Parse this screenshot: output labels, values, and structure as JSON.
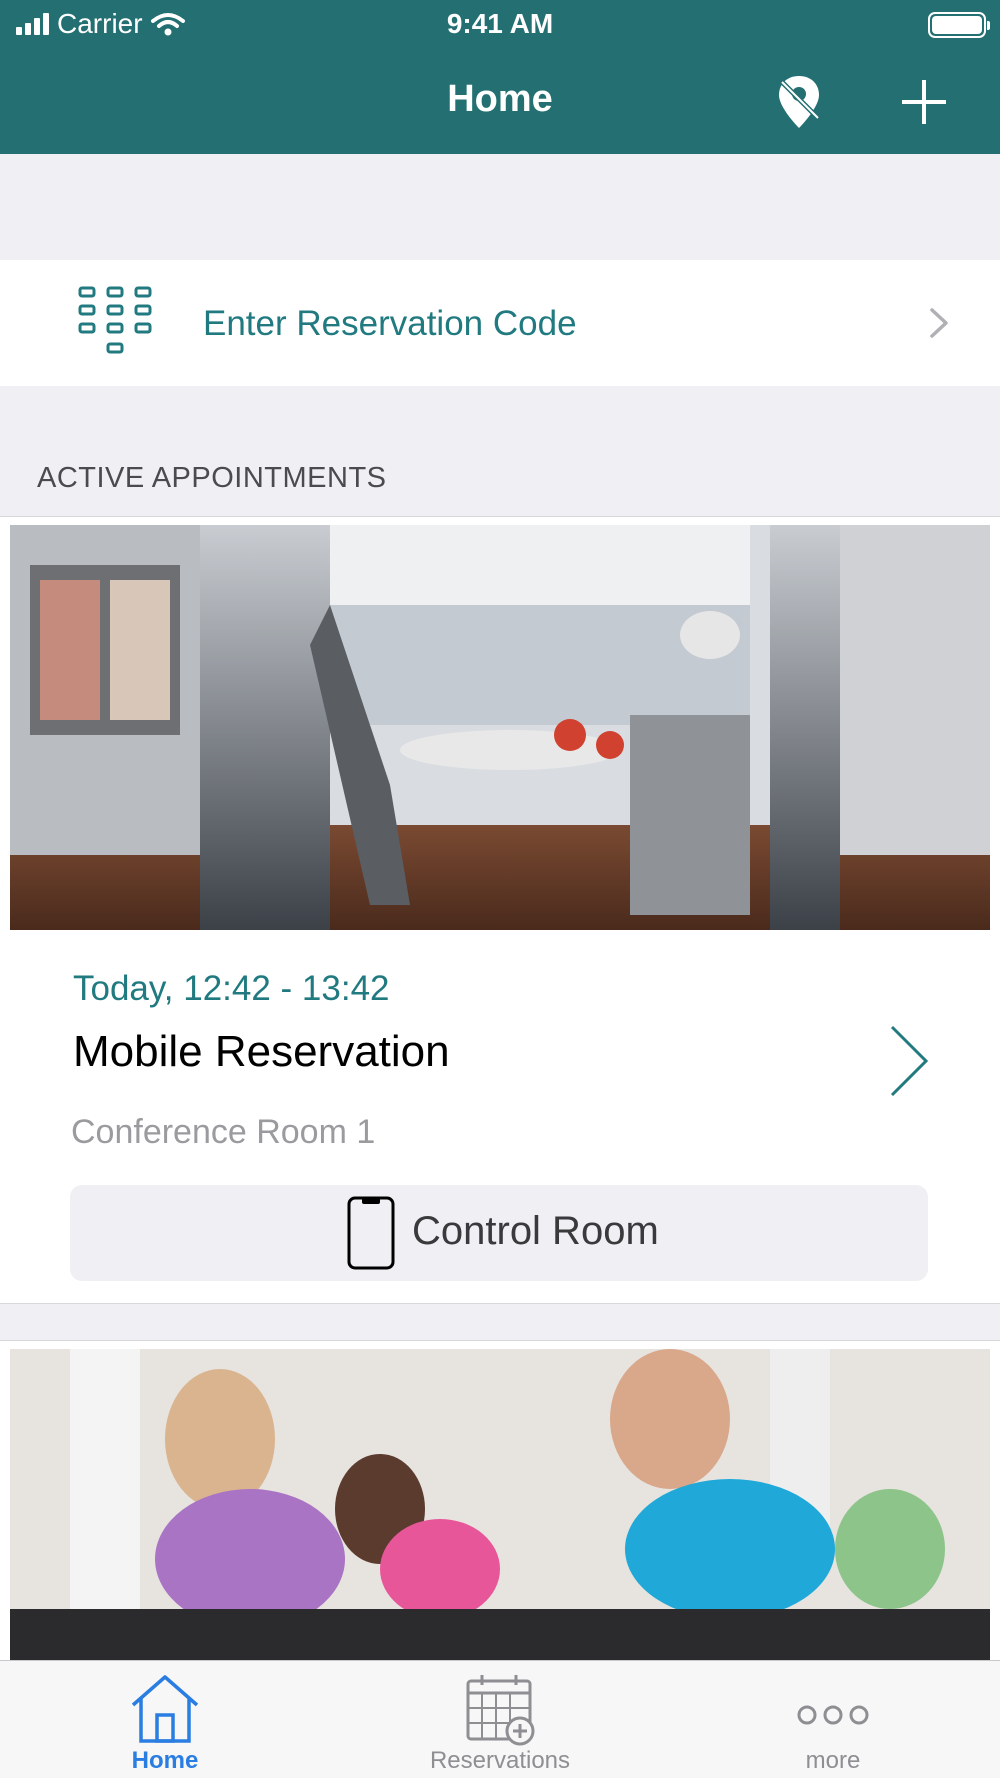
{
  "status_bar": {
    "carrier": "Carrier",
    "time": "9:41 AM"
  },
  "nav": {
    "title": "Home",
    "location_icon": "location-pin-icon",
    "add_icon": "plus-icon"
  },
  "reservation_code": {
    "label": "Enter Reservation Code",
    "icon": "keypad-icon"
  },
  "section": {
    "title": "ACTIVE APPOINTMENTS"
  },
  "appointment": {
    "time": "Today, 12:42 - 13:42",
    "title": "Mobile Reservation",
    "room": "Conference Room 1",
    "control_label": "Control Room"
  },
  "tabs": [
    {
      "label": "Home",
      "icon": "home-icon",
      "active": true
    },
    {
      "label": "Reservations",
      "icon": "calendar-add-icon",
      "active": false
    },
    {
      "label": "more",
      "icon": "more-icon",
      "active": false
    }
  ],
  "colors": {
    "header": "#236f72",
    "accent": "#217a80",
    "tab_active": "#2a7de1",
    "tab_inactive": "#8e8e93"
  }
}
